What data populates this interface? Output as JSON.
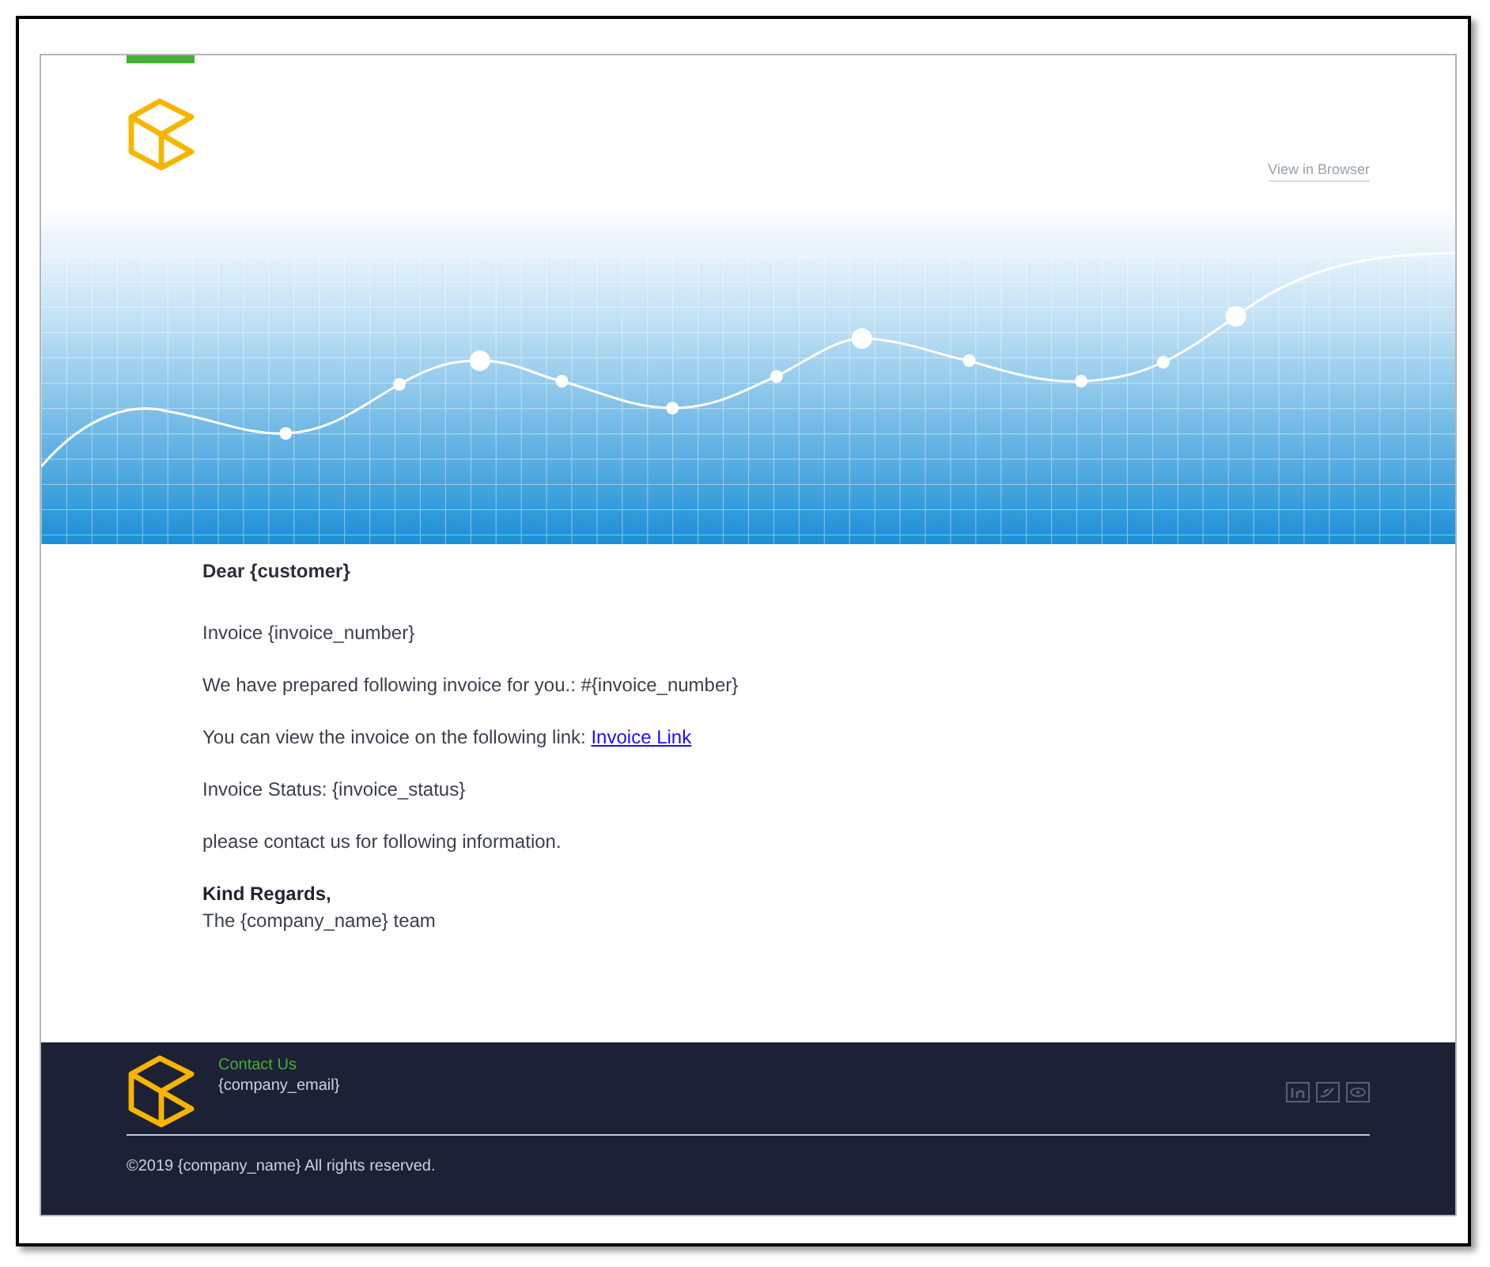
{
  "header": {
    "view_in_browser": "View in Browser"
  },
  "body": {
    "greeting": "Dear {customer}",
    "paragraphs": [
      {
        "text": "Invoice {invoice_number}"
      },
      {
        "text": "We have prepared following invoice for you.: #{invoice_number}"
      },
      {
        "text": "You can view the invoice on the following link: ",
        "link": "Invoice Link"
      },
      {
        "text": "Invoice Status: {invoice_status}"
      },
      {
        "text": "please contact us for following information."
      }
    ],
    "closing": "Kind Regards,",
    "team": "The {company_name} team"
  },
  "footer": {
    "contact_heading": "Contact Us",
    "email": "{company_email}",
    "copyright": "©2019 {company_name} All rights reserved.",
    "social": [
      {
        "kind": "linkedin"
      },
      {
        "kind": "twitter"
      },
      {
        "kind": "eye"
      }
    ]
  }
}
